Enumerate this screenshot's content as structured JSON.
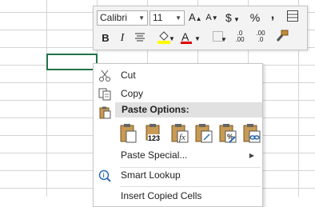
{
  "toolbar": {
    "font_name": "Calibri",
    "font_size": "11",
    "grow_font": "A",
    "shrink_font": "A",
    "currency": "$",
    "percent": "%",
    "comma": ",",
    "bold": "B",
    "italic": "I",
    "font_color_letter": "A",
    "inc_decimal_top": ".0",
    "inc_decimal_bottom": ".00",
    "dec_decimal_top": ".00",
    "dec_decimal_bottom": ".0",
    "highlight_color": "#ffff00",
    "font_color": "#e00000"
  },
  "menu": {
    "cut": "Cut",
    "copy": "Copy",
    "paste_options": "Paste Options:",
    "paste_values_badge": "123",
    "paste_special": "Paste Special...",
    "smart_lookup": "Smart Lookup",
    "insert_copied_cells": "Insert Copied Cells"
  },
  "colors": {
    "selection": "#217346",
    "accent": "#2e6db4"
  }
}
